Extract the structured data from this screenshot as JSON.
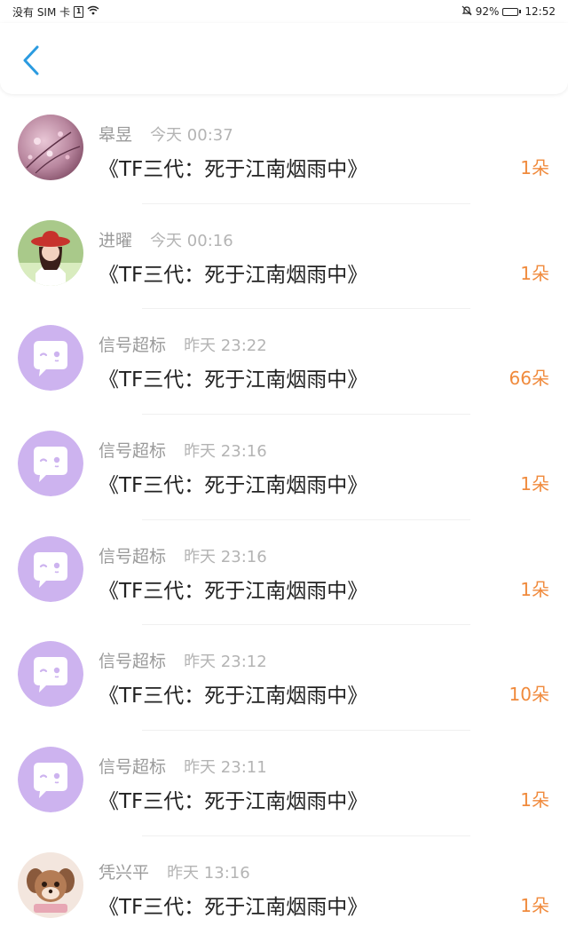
{
  "status_bar": {
    "carrier": "没有 SIM 卡",
    "sim_badge": "1",
    "battery": "92%",
    "battery_level": 0.92,
    "time": "12:52"
  },
  "header": {
    "back_icon": "chevron-left-icon",
    "accent": "#2b9be0"
  },
  "colors": {
    "count": "#f08a3c",
    "avatar_default": "#cdb3ef"
  },
  "gifts": [
    {
      "name": "皋昱",
      "time": "今天 00:37",
      "title": "《TF三代：死于江南烟雨中》",
      "count": "1朵",
      "avatar": "photo-flowers"
    },
    {
      "name": "进曜",
      "time": "今天 00:16",
      "title": "《TF三代：死于江南烟雨中》",
      "count": "1朵",
      "avatar": "photo-girl-hat"
    },
    {
      "name": "信号超标",
      "time": "昨天 23:22",
      "title": "《TF三代：死于江南烟雨中》",
      "count": "66朵",
      "avatar": "default"
    },
    {
      "name": "信号超标",
      "time": "昨天 23:16",
      "title": "《TF三代：死于江南烟雨中》",
      "count": "1朵",
      "avatar": "default"
    },
    {
      "name": "信号超标",
      "time": "昨天 23:16",
      "title": "《TF三代：死于江南烟雨中》",
      "count": "1朵",
      "avatar": "default"
    },
    {
      "name": "信号超标",
      "time": "昨天 23:12",
      "title": "《TF三代：死于江南烟雨中》",
      "count": "10朵",
      "avatar": "default"
    },
    {
      "name": "信号超标",
      "time": "昨天 23:11",
      "title": "《TF三代：死于江南烟雨中》",
      "count": "1朵",
      "avatar": "default"
    },
    {
      "name": "凭兴平",
      "time": "昨天 13:16",
      "title": "《TF三代：死于江南烟雨中》",
      "count": "1朵",
      "avatar": "photo-cartoon-dog"
    }
  ]
}
